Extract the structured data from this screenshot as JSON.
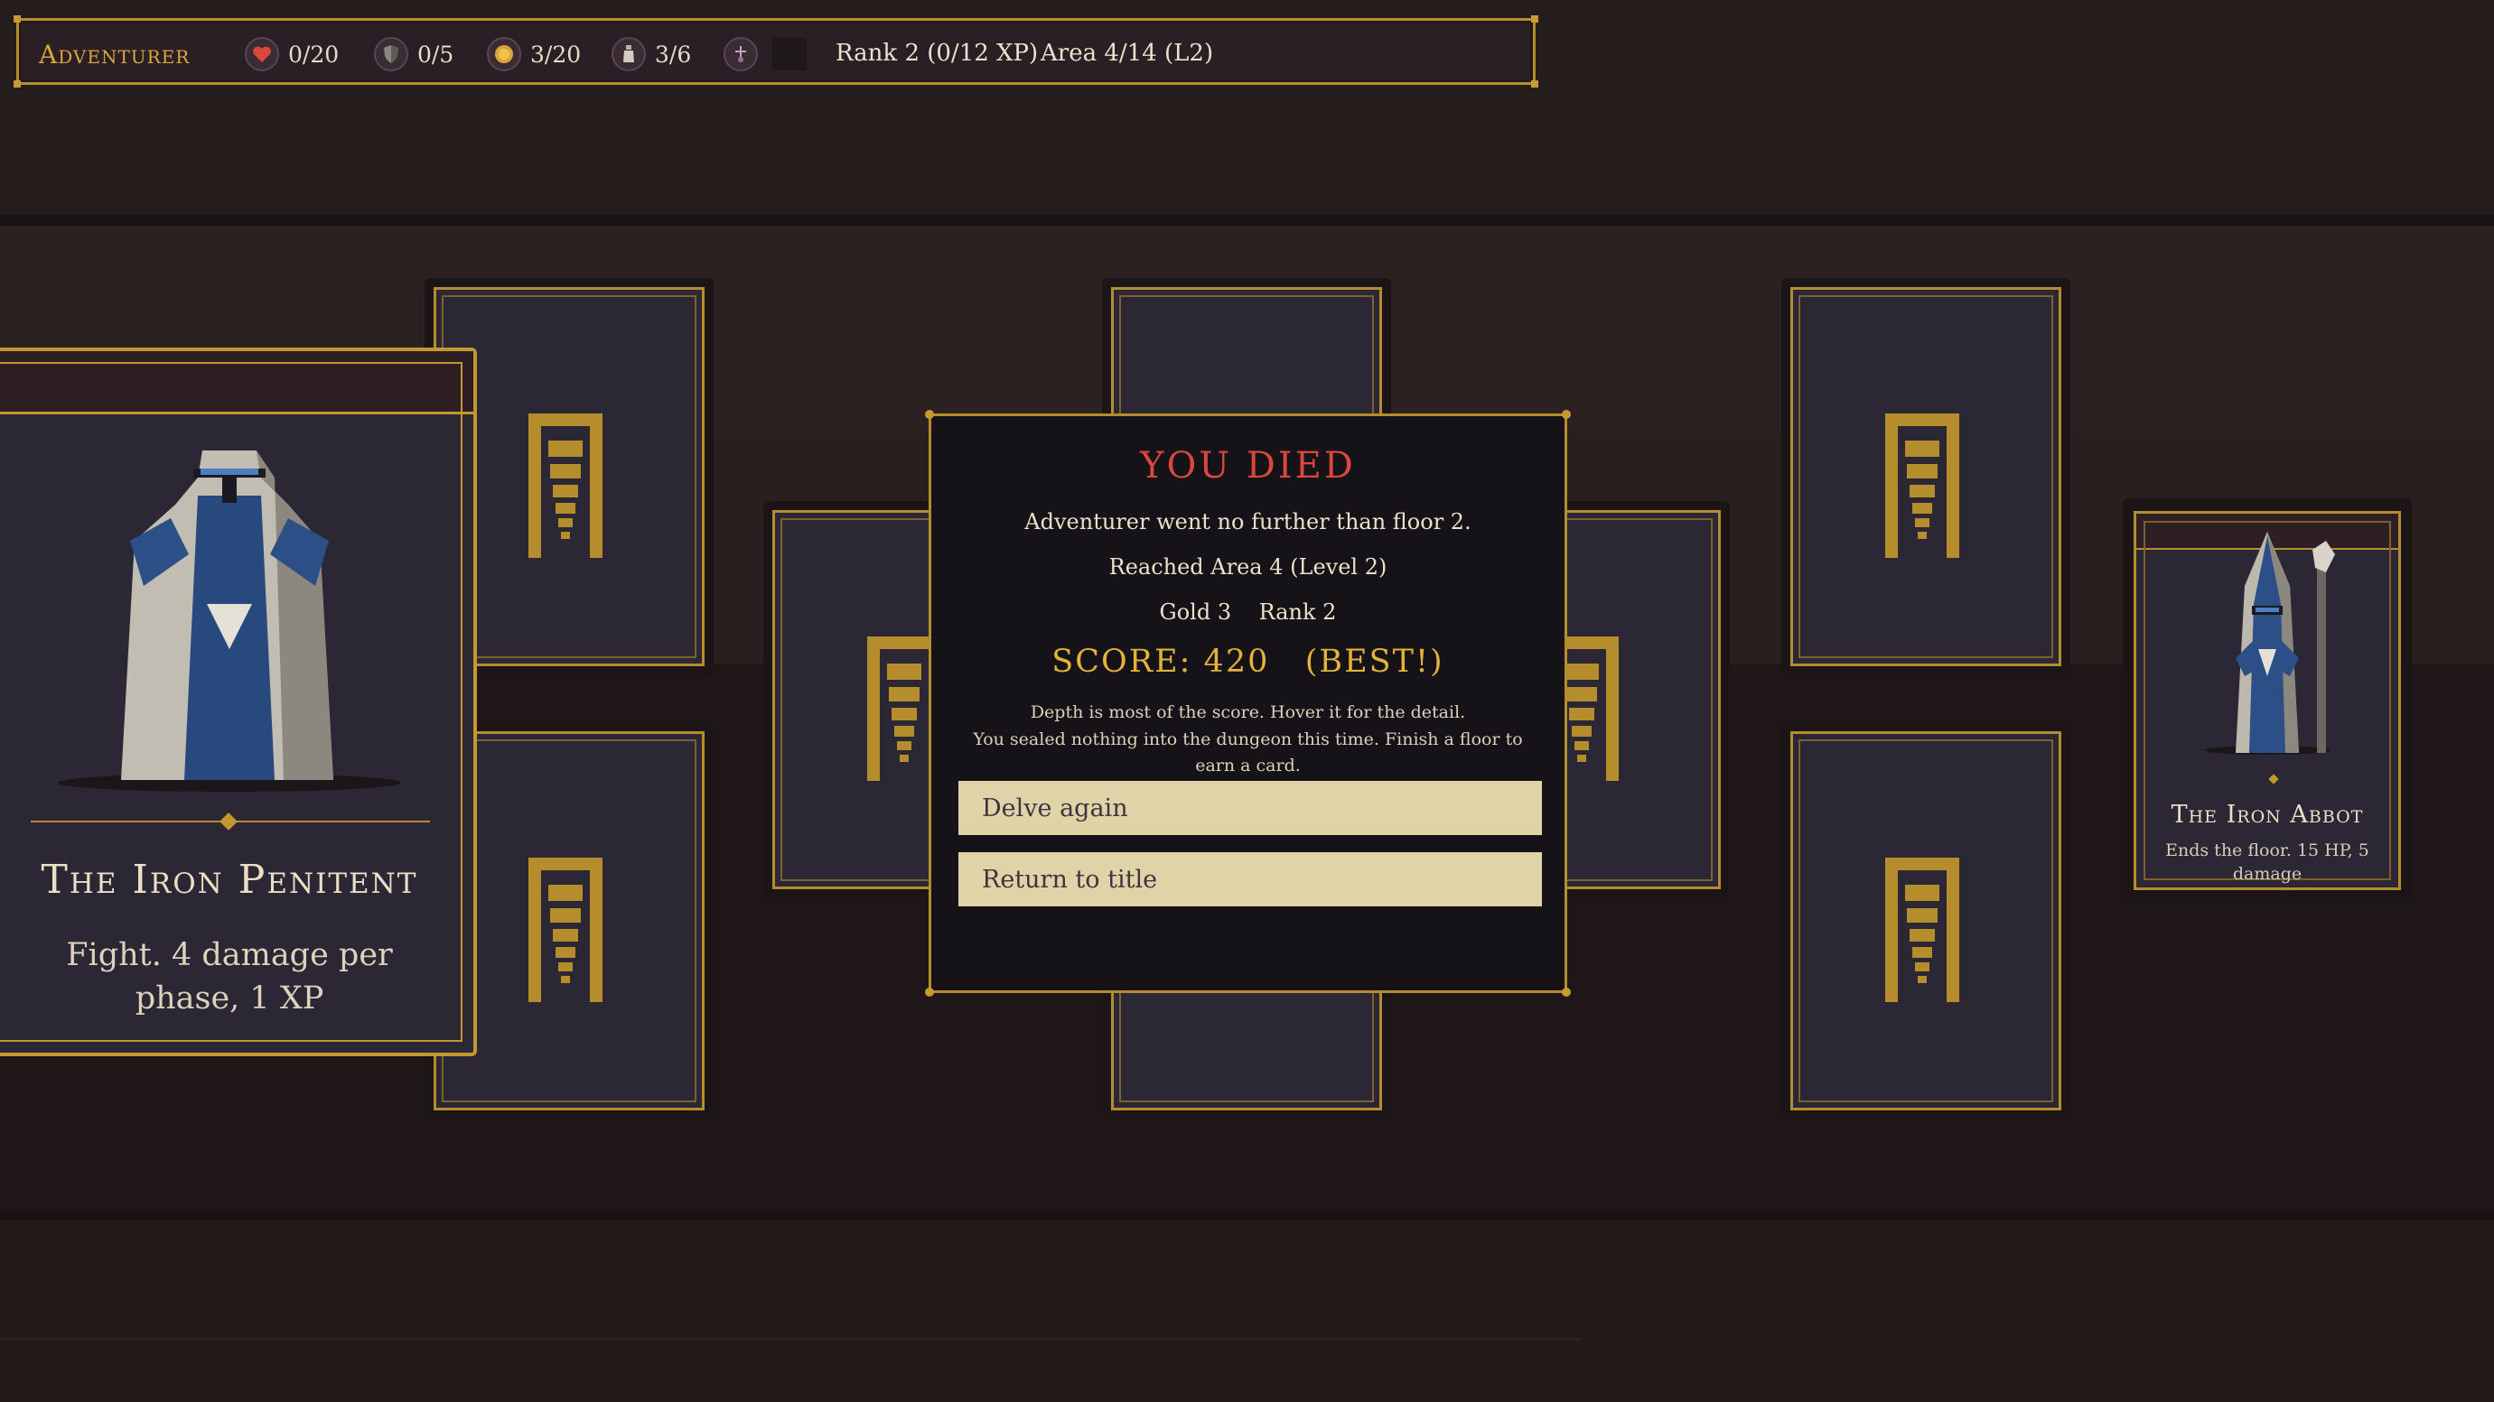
{
  "hud": {
    "title": "Adventurer",
    "health": "0/20",
    "armor": "0/5",
    "gold": "3/20",
    "potions": "3/6",
    "rank": "Rank 2 (0/12 XP)",
    "area": "Area 4/14 (L2)"
  },
  "icons": {
    "health": "heart-icon",
    "armor": "shield-icon",
    "gold": "coin-icon",
    "potions": "potion-icon",
    "relic": "relic-icon",
    "card_back": "stairs-icon"
  },
  "colors": {
    "accent_gold": "#c4982f",
    "death_red": "#d8483e",
    "score_gold": "#e2b23a",
    "card_face": "#2b2735",
    "button_bg": "#e0d3a8"
  },
  "featured_card": {
    "name": "The Iron Penitent",
    "description": "Fight. 4 damage per phase, 1 XP"
  },
  "boss_card": {
    "name": "The Iron Abbot",
    "description": "Ends the floor. 15 HP, 5 damage"
  },
  "modal": {
    "title": "YOU DIED",
    "line1": "Adventurer went no further than floor 2.",
    "line2": "Reached Area 4 (Level 2)",
    "gold": "Gold 3",
    "rank": "Rank 2",
    "score": "SCORE: 420",
    "best": "(BEST!)",
    "hint": "Depth is most of the score. Hover it for the detail.",
    "sealed": "You sealed nothing into the dungeon this time. Finish a floor to earn a card.",
    "delve_again": "Delve again",
    "return_title": "Return to title"
  }
}
